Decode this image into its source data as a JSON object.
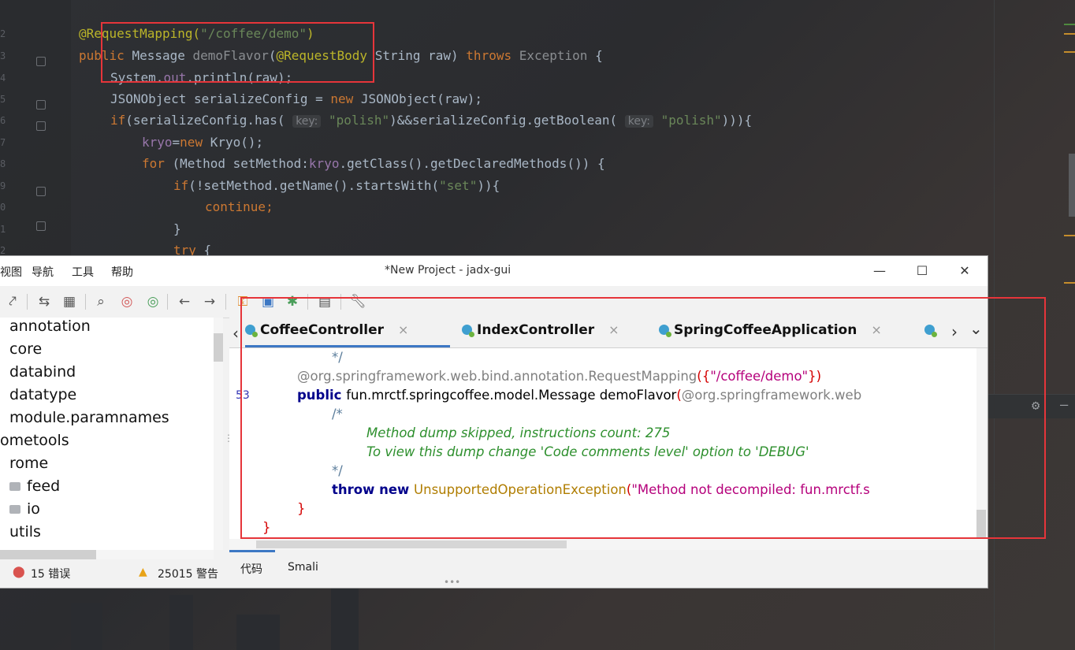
{
  "ide_background": {
    "code_lines": [
      {
        "parts": [
          [
            "a",
            "@RequestMapping("
          ],
          [
            "s",
            "\"/coffee/demo\""
          ],
          [
            "a",
            ")"
          ]
        ]
      },
      {
        "parts": [
          [
            "k",
            "public "
          ],
          [
            "",
            "Message "
          ],
          [
            "dim",
            "demoFlavor"
          ],
          [
            "",
            "("
          ],
          [
            "a",
            "@RequestBody "
          ],
          [
            "",
            "String raw) "
          ],
          [
            "k",
            "throws "
          ],
          [
            "dim",
            "Exception "
          ],
          [
            "",
            "{"
          ]
        ]
      },
      {
        "parts": [
          [
            "",
            "System."
          ],
          [
            "f",
            "out"
          ],
          [
            "",
            ".println(raw);"
          ]
        ]
      },
      {
        "parts": [
          [
            "",
            "JSONObject serializeConfig = "
          ],
          [
            "k",
            "new "
          ],
          [
            "",
            "JSONObject(raw);"
          ]
        ]
      },
      {
        "parts": [
          [
            "k",
            "if"
          ],
          [
            "",
            "(serializeConfig.has( "
          ],
          [
            "hint",
            "key:"
          ],
          [
            "s",
            " \"polish\""
          ],
          [
            "",
            ")&&serializeConfig.getBoolean( "
          ],
          [
            "hint",
            "key:"
          ],
          [
            "s",
            " \"polish\""
          ],
          [
            "",
            "))){"
          ]
        ]
      },
      {
        "parts": [
          [
            "f",
            "kryo"
          ],
          [
            "",
            "="
          ],
          [
            "k",
            "new "
          ],
          [
            "",
            "Kryo();"
          ]
        ]
      },
      {
        "parts": [
          [
            "k",
            "for "
          ],
          [
            "",
            "(Method setMethod:"
          ],
          [
            "f",
            "kryo"
          ],
          [
            "",
            ".getClass().getDeclaredMethods()) {"
          ]
        ]
      },
      {
        "parts": [
          [
            "k",
            "if"
          ],
          [
            "",
            "(!setMethod.getName().startsWith("
          ],
          [
            "s",
            "\"set\""
          ],
          [
            "",
            "))"
          ],
          [
            "",
            "{"
          ]
        ]
      },
      {
        "parts": [
          [
            "k",
            "continue;"
          ]
        ]
      },
      {
        "parts": [
          [
            "",
            "}"
          ]
        ]
      },
      {
        "parts": [
          [
            "k",
            "try "
          ],
          [
            "",
            "{"
          ]
        ]
      }
    ],
    "line_numbers": [
      "2",
      "3",
      "4",
      "5",
      "6",
      "7",
      "8",
      "9",
      "0",
      "1",
      "2"
    ]
  },
  "window": {
    "title": "*New Project - jadx-gui",
    "menu": [
      "视图",
      "导航",
      "工具",
      "帮助"
    ],
    "minimize": "—",
    "maximize": "☐",
    "close": "✕"
  },
  "toolbar_icons": [
    "export-icon",
    "sync-tree-icon",
    "flatten-packages-icon",
    "search-icon",
    "search-class-icon",
    "search-usage-icon",
    "back-arrow-icon",
    "forward-arrow-icon",
    "deobfuscation-icon",
    "quark-icon",
    "log-icon",
    "preferences-icon"
  ],
  "tree": {
    "items": [
      {
        "label": "annotation",
        "folder": false
      },
      {
        "label": "core",
        "folder": false
      },
      {
        "label": "databind",
        "folder": false
      },
      {
        "label": "datatype",
        "folder": false
      },
      {
        "label": "module.paramnames",
        "folder": false
      },
      {
        "label": "ometools",
        "folder": false
      },
      {
        "label": "rome",
        "folder": false
      },
      {
        "label": "feed",
        "folder": true
      },
      {
        "label": "io",
        "folder": true
      },
      {
        "label": "utils",
        "folder": false
      }
    ]
  },
  "status": {
    "errors": "15 错误",
    "warnings": "25015 警告"
  },
  "tabs": [
    {
      "label": "CoffeeController",
      "active": true
    },
    {
      "label": "IndexController",
      "active": false
    },
    {
      "label": "SpringCoffeeApplication",
      "active": false
    }
  ],
  "tab_nav": {
    "left": "‹",
    "right": "›",
    "more": "⌄"
  },
  "code": {
    "line_number": "53",
    "lines": [
      {
        "indent": "        ",
        "parts": [
          [
            "cm",
            "*/"
          ]
        ]
      },
      {
        "indent": "    ",
        "parts": [
          [
            "an",
            "@org.springframework.web.bind.annotation.RequestMapping"
          ],
          [
            "br",
            "({"
          ],
          [
            "st2",
            "\"/coffee/demo\""
          ],
          [
            "br",
            "})"
          ]
        ]
      },
      {
        "indent": "    ",
        "parts": [
          [
            "kw",
            "public "
          ],
          [
            "",
            "fun.mrctf.springcoffee.model.Message demoFlavor"
          ],
          [
            "br",
            "("
          ],
          [
            "an",
            "@org.springframework.web"
          ]
        ]
      },
      {
        "indent": "        ",
        "parts": [
          [
            "cm",
            "/*"
          ]
        ]
      },
      {
        "indent": "            ",
        "parts": [
          [
            "cmi",
            "Method dump skipped, instructions count: 275"
          ]
        ]
      },
      {
        "indent": "            ",
        "parts": [
          [
            "cmi",
            "To view this dump change 'Code comments level' option to 'DEBUG'"
          ]
        ]
      },
      {
        "indent": "        ",
        "parts": [
          [
            "cm",
            "*/"
          ]
        ]
      },
      {
        "indent": "        ",
        "parts": [
          [
            "kw",
            "throw "
          ],
          [
            "kw",
            "new "
          ],
          [
            "cls",
            "UnsupportedOperationException"
          ],
          [
            "br",
            "("
          ],
          [
            "st2",
            "\"Method not decompiled: fun.mrctf.s"
          ]
        ]
      },
      {
        "indent": "    ",
        "parts": [
          [
            "br",
            "}"
          ]
        ]
      },
      {
        "indent": "",
        "parts": [
          [
            "br",
            "}"
          ]
        ]
      }
    ]
  },
  "bottom_tabs": [
    "代码",
    "Smali"
  ],
  "colors": {
    "highlight_box": "#e6353a",
    "accent": "#3d78c4"
  }
}
